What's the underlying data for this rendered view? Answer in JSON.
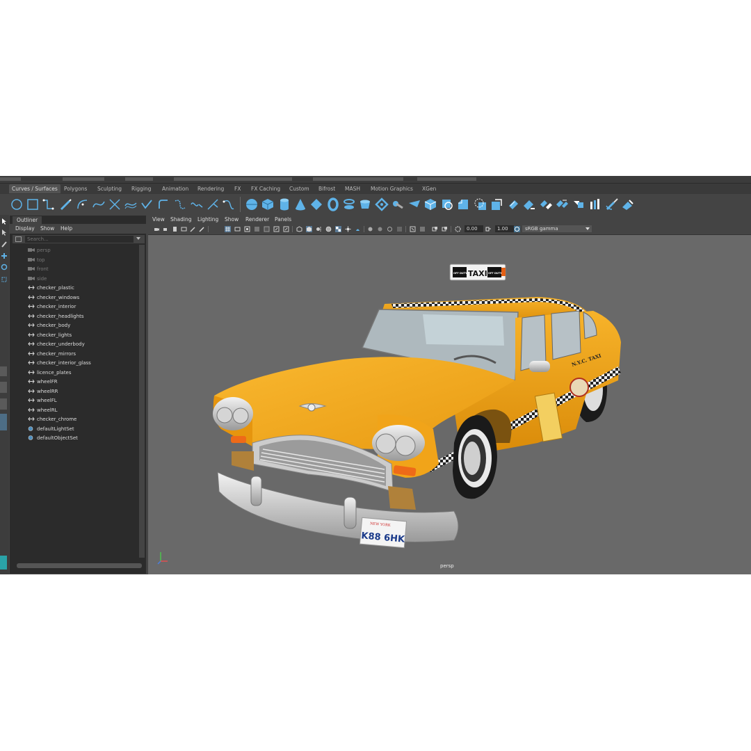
{
  "shelf": {
    "tabs": [
      "Curves / Surfaces",
      "Polygons",
      "Sculpting",
      "Rigging",
      "Animation",
      "Rendering",
      "FX",
      "FX Caching",
      "Custom",
      "Bifrost",
      "MASH",
      "Motion Graphics",
      "XGen"
    ],
    "active_tab": "Curves / Surfaces",
    "icon_color": "#5fb3e8"
  },
  "outliner": {
    "tab": "Outliner",
    "menu": [
      "Display",
      "Show",
      "Help"
    ],
    "search_placeholder": "Search...",
    "items": [
      {
        "label": "persp",
        "type": "camera",
        "dim": true
      },
      {
        "label": "top",
        "type": "camera",
        "dim": true
      },
      {
        "label": "front",
        "type": "camera",
        "dim": true
      },
      {
        "label": "side",
        "type": "camera",
        "dim": true
      },
      {
        "label": "checker_plastic",
        "type": "group",
        "dim": false
      },
      {
        "label": "checker_windows",
        "type": "group",
        "dim": false
      },
      {
        "label": "checker_interior",
        "type": "group",
        "dim": false
      },
      {
        "label": "checker_headlights",
        "type": "group",
        "dim": false
      },
      {
        "label": "checker_body",
        "type": "group",
        "dim": false
      },
      {
        "label": "checker_lights",
        "type": "group",
        "dim": false
      },
      {
        "label": "checker_underbody",
        "type": "group",
        "dim": false
      },
      {
        "label": "checker_mirrors",
        "type": "group",
        "dim": false
      },
      {
        "label": "checker_interior_glass",
        "type": "group",
        "dim": false
      },
      {
        "label": "licence_plates",
        "type": "group",
        "dim": false
      },
      {
        "label": "wheelFR",
        "type": "group",
        "dim": false
      },
      {
        "label": "wheelRR",
        "type": "group",
        "dim": false
      },
      {
        "label": "wheelFL",
        "type": "group",
        "dim": false
      },
      {
        "label": "wheelRL",
        "type": "group",
        "dim": false
      },
      {
        "label": "checker_chrome",
        "type": "group",
        "dim": false
      },
      {
        "label": "defaultLightSet",
        "type": "set",
        "dim": false
      },
      {
        "label": "defaultObjectSet",
        "type": "set",
        "dim": false
      }
    ]
  },
  "viewport": {
    "menu": [
      "View",
      "Shading",
      "Lighting",
      "Show",
      "Renderer",
      "Panels"
    ],
    "exposure": "0.00",
    "gamma": "1.00",
    "color_management": "sRGB gamma",
    "camera_label": "persp",
    "background": "#696969"
  },
  "scene": {
    "roof_sign": {
      "left": "OFF DUTY",
      "center": "TAXI",
      "right": "OFF DUTY"
    },
    "plate_state": "NEW YORK",
    "plate_number": "K88 6HK",
    "door_text": "N.Y.C. TAXI",
    "body_color": "#f0a012"
  }
}
